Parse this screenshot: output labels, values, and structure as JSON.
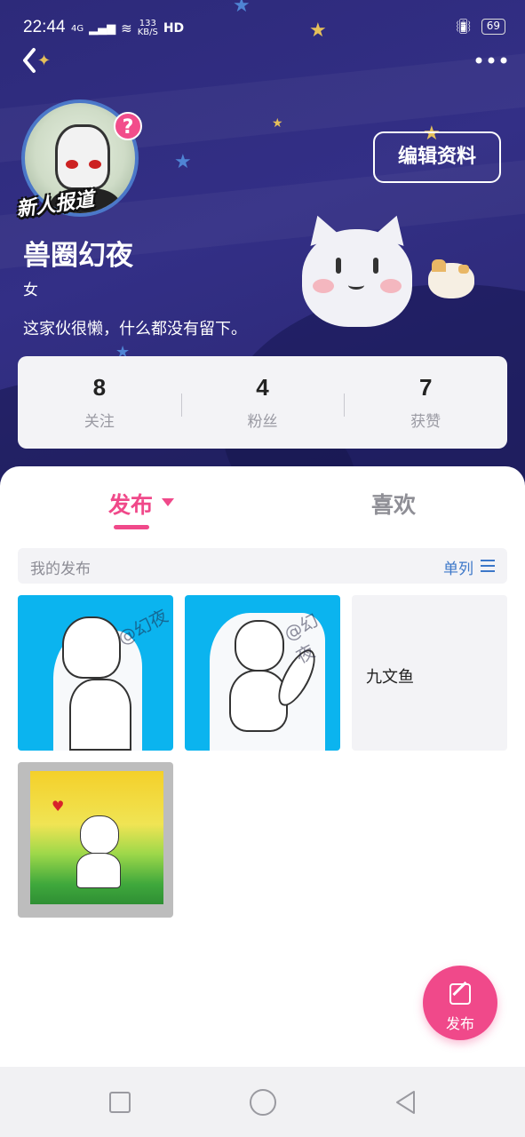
{
  "status_bar": {
    "time": "22:44",
    "network": "4G",
    "speed_value": "133",
    "speed_unit": "KB/S",
    "hd": "HD",
    "battery": "69"
  },
  "header": {
    "more_icon": "more-horizontal-icon",
    "back_icon": "back-arrow-icon"
  },
  "profile": {
    "badge_text": "新人报道",
    "question_badge": "?",
    "edit_label": "编辑资料",
    "username": "兽圈幻夜",
    "gender": "女",
    "bio": "这家伙很懒，什么都没有留下。"
  },
  "stats": [
    {
      "value": "8",
      "label": "关注"
    },
    {
      "value": "4",
      "label": "粉丝"
    },
    {
      "value": "7",
      "label": "获赞"
    }
  ],
  "tabs": {
    "publish": "发布",
    "likes": "喜欢"
  },
  "filter": {
    "label": "我的发布",
    "mode": "单列"
  },
  "posts": [
    {
      "type": "image",
      "watermark": "@幻夜"
    },
    {
      "type": "image",
      "watermark": "@幻夜"
    },
    {
      "type": "text",
      "text": "九文鱼"
    },
    {
      "type": "image"
    }
  ],
  "fab": {
    "label": "发布"
  },
  "colors": {
    "accent": "#f0498a",
    "link": "#3d78c9",
    "header_bg": "#2d2a7a"
  }
}
